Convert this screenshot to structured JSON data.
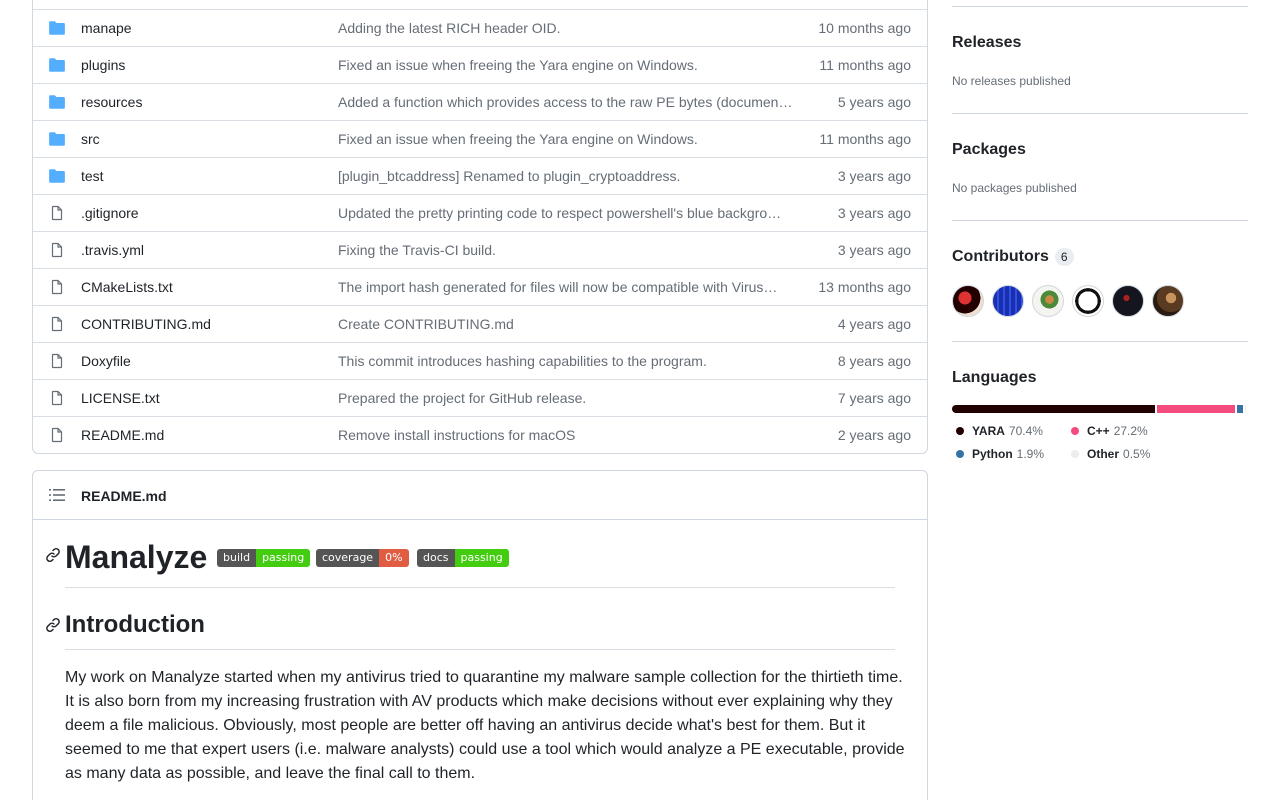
{
  "files": [
    {
      "type": "dir",
      "name": "manape",
      "message": "Adding the latest RICH header OID.",
      "time": "10 months ago"
    },
    {
      "type": "dir",
      "name": "plugins",
      "message": "Fixed an issue when freeing the Yara engine on Windows.",
      "time": "11 months ago"
    },
    {
      "type": "dir",
      "name": "resources",
      "message": "Added a function which provides access to the raw PE bytes (documen…",
      "time": "5 years ago"
    },
    {
      "type": "dir",
      "name": "src",
      "message": "Fixed an issue when freeing the Yara engine on Windows.",
      "time": "11 months ago"
    },
    {
      "type": "dir",
      "name": "test",
      "message": "[plugin_btcaddress] Renamed to plugin_cryptoaddress.",
      "time": "3 years ago"
    },
    {
      "type": "file",
      "name": ".gitignore",
      "message": "Updated the pretty printing code to respect powershell's blue backgro…",
      "time": "3 years ago"
    },
    {
      "type": "file",
      "name": ".travis.yml",
      "message": "Fixing the Travis-CI build.",
      "time": "3 years ago"
    },
    {
      "type": "file",
      "name": "CMakeLists.txt",
      "message": "The import hash generated for files will now be compatible with Virus…",
      "time": "13 months ago"
    },
    {
      "type": "file",
      "name": "CONTRIBUTING.md",
      "message": "Create CONTRIBUTING.md",
      "time": "4 years ago"
    },
    {
      "type": "file",
      "name": "Doxyfile",
      "message": "This commit introduces hashing capabilities to the program.",
      "time": "8 years ago"
    },
    {
      "type": "file",
      "name": "LICENSE.txt",
      "message": "Prepared the project for GitHub release.",
      "time": "7 years ago"
    },
    {
      "type": "file",
      "name": "README.md",
      "message": "Remove install instructions for macOS",
      "time": "2 years ago"
    }
  ],
  "readme": {
    "filename": "README.md",
    "title": "Manalyze",
    "badges": [
      {
        "label": "build",
        "value": "passing",
        "color": "#4c1"
      },
      {
        "label": "coverage",
        "value": "0%",
        "color": "#e05d44"
      },
      {
        "label": "docs",
        "value": "passing",
        "color": "#4c1"
      }
    ],
    "intro_heading": "Introduction",
    "intro_text": "My work on Manalyze started when my antivirus tried to quarantine my malware sample collection for the thirtieth time. It is also born from my increasing frustration with AV products which make decisions without ever explaining why they deem a file malicious. Obviously, most people are better off having an antivirus decide what's best for them. But it seemed to me that expert users (i.e. malware analysts) could use a tool which would analyze a PE executable, provide as many data as possible, and leave the final call to them."
  },
  "sidebar": {
    "releases": {
      "heading": "Releases",
      "text": "No releases published"
    },
    "packages": {
      "heading": "Packages",
      "text": "No packages published"
    },
    "contributors": {
      "heading": "Contributors",
      "count": "6"
    },
    "languages": {
      "heading": "Languages",
      "items": [
        {
          "name": "YARA",
          "pct": "70.4%",
          "value": 70.4,
          "color": "#220000"
        },
        {
          "name": "C++",
          "pct": "27.2%",
          "value": 27.2,
          "color": "#f34b7d"
        },
        {
          "name": "Python",
          "pct": "1.9%",
          "value": 1.9,
          "color": "#3572A5"
        },
        {
          "name": "Other",
          "pct": "0.5%",
          "value": 0.5,
          "color": "#ededed"
        }
      ]
    }
  }
}
